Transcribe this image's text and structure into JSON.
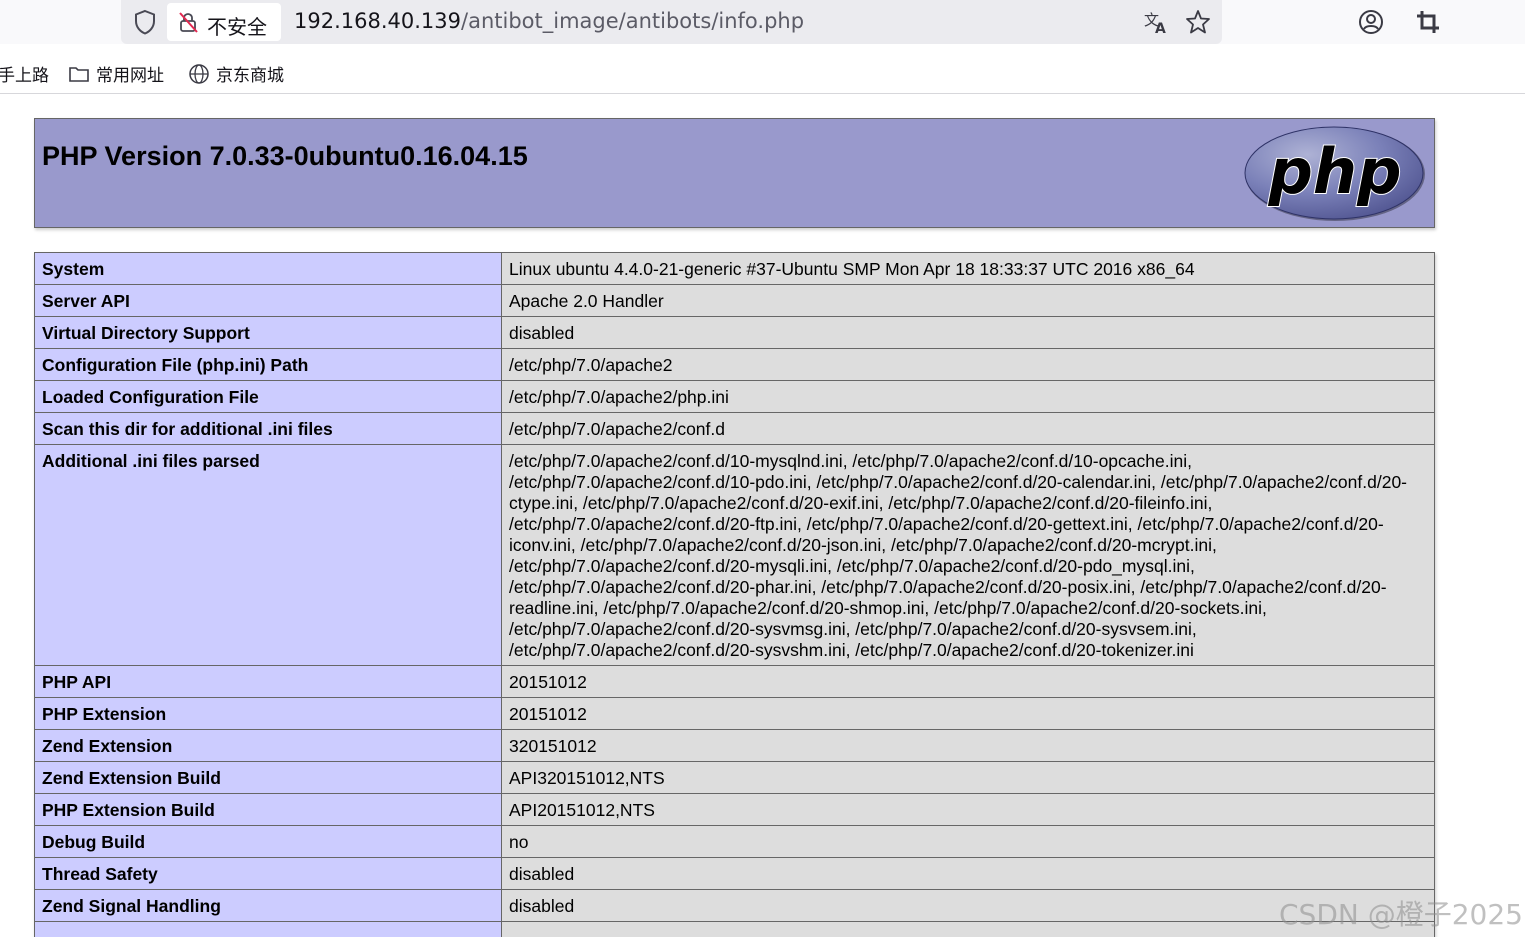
{
  "browser": {
    "security_label": "不安全",
    "url_host": "192.168.40.139",
    "url_path": "/antibot_image/antibots/info.php",
    "bookmarks": [
      {
        "label": "手上路",
        "icon": "none"
      },
      {
        "label": "常用网址",
        "icon": "folder-icon"
      },
      {
        "label": "京东商城",
        "icon": "globe-icon"
      }
    ]
  },
  "phpinfo": {
    "title": "PHP Version 7.0.33-0ubuntu0.16.04.15",
    "logo_text": "php",
    "rows": [
      {
        "key": "System",
        "value": "Linux ubuntu 4.4.0-21-generic #37-Ubuntu SMP Mon Apr 18 18:33:37 UTC 2016 x86_64"
      },
      {
        "key": "Server API",
        "value": "Apache 2.0 Handler"
      },
      {
        "key": "Virtual Directory Support",
        "value": "disabled"
      },
      {
        "key": "Configuration File (php.ini) Path",
        "value": "/etc/php/7.0/apache2"
      },
      {
        "key": "Loaded Configuration File",
        "value": "/etc/php/7.0/apache2/php.ini"
      },
      {
        "key": "Scan this dir for additional .ini files",
        "value": "/etc/php/7.0/apache2/conf.d"
      },
      {
        "key": "Additional .ini files parsed",
        "value": "/etc/php/7.0/apache2/conf.d/10-mysqlnd.ini, /etc/php/7.0/apache2/conf.d/10-opcache.ini, /etc/php/7.0/apache2/conf.d/10-pdo.ini, /etc/php/7.0/apache2/conf.d/20-calendar.ini, /etc/php/7.0/apache2/conf.d/20-ctype.ini, /etc/php/7.0/apache2/conf.d/20-exif.ini, /etc/php/7.0/apache2/conf.d/20-fileinfo.ini, /etc/php/7.0/apache2/conf.d/20-ftp.ini, /etc/php/7.0/apache2/conf.d/20-gettext.ini, /etc/php/7.0/apache2/conf.d/20-iconv.ini, /etc/php/7.0/apache2/conf.d/20-json.ini, /etc/php/7.0/apache2/conf.d/20-mcrypt.ini, /etc/php/7.0/apache2/conf.d/20-mysqli.ini, /etc/php/7.0/apache2/conf.d/20-pdo_mysql.ini, /etc/php/7.0/apache2/conf.d/20-phar.ini, /etc/php/7.0/apache2/conf.d/20-posix.ini, /etc/php/7.0/apache2/conf.d/20-readline.ini, /etc/php/7.0/apache2/conf.d/20-shmop.ini, /etc/php/7.0/apache2/conf.d/20-sockets.ini, /etc/php/7.0/apache2/conf.d/20-sysvmsg.ini, /etc/php/7.0/apache2/conf.d/20-sysvsem.ini, /etc/php/7.0/apache2/conf.d/20-sysvshm.ini, /etc/php/7.0/apache2/conf.d/20-tokenizer.ini"
      },
      {
        "key": "PHP API",
        "value": "20151012"
      },
      {
        "key": "PHP Extension",
        "value": "20151012"
      },
      {
        "key": "Zend Extension",
        "value": "320151012"
      },
      {
        "key": "Zend Extension Build",
        "value": "API320151012,NTS"
      },
      {
        "key": "PHP Extension Build",
        "value": "API20151012,NTS"
      },
      {
        "key": "Debug Build",
        "value": "no"
      },
      {
        "key": "Thread Safety",
        "value": "disabled"
      },
      {
        "key": "Zend Signal Handling",
        "value": "disabled"
      },
      {
        "key": "",
        "value": ""
      }
    ]
  },
  "watermark": "CSDN @橙子2025",
  "colors": {
    "header_bg": "#9999cc",
    "key_bg": "#ccccff",
    "value_bg": "#dddddd",
    "border": "#666666"
  }
}
